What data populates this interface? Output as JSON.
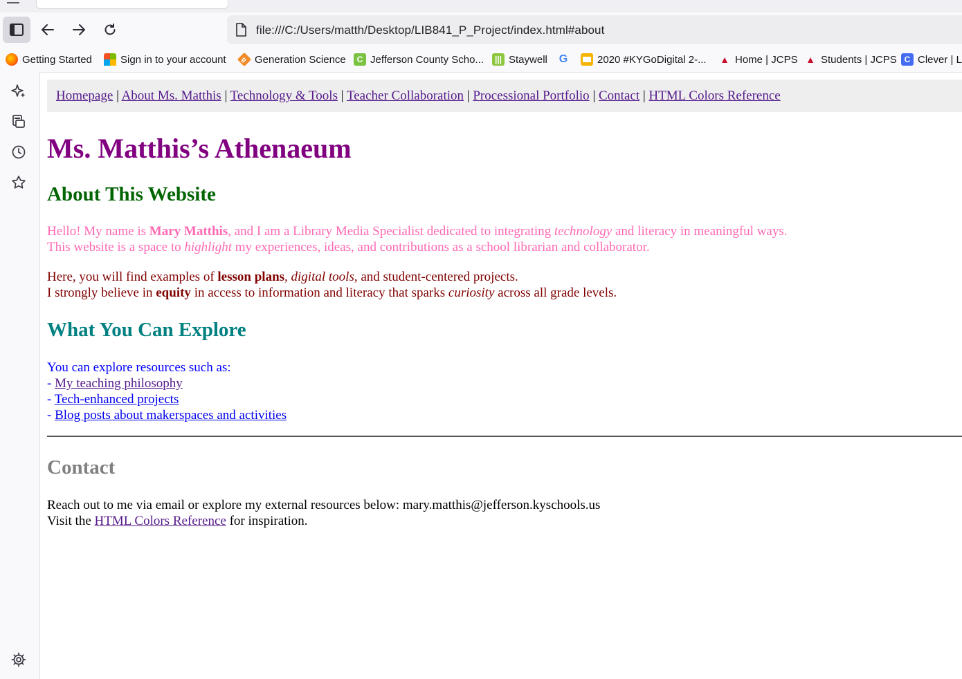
{
  "browser": {
    "url": "file:///C:/Users/matth/Desktop/LIB841_P_Project/index.html#about",
    "bookmarks": [
      {
        "label": "Getting Started",
        "icon": "firefox-icon"
      },
      {
        "label": "Sign in to your account",
        "icon": "microsoft-icon"
      },
      {
        "label": "Generation Science",
        "icon": "generation-science-icon"
      },
      {
        "label": "Jefferson County Scho...",
        "icon": "clever-green-icon"
      },
      {
        "label": "Staywell",
        "icon": "staywell-icon"
      },
      {
        "label": "",
        "icon": "google-icon"
      },
      {
        "label": "2020 #KYGoDigital 2-...",
        "icon": "slides-icon"
      },
      {
        "label": "Home | JCPS",
        "icon": "jcps-icon"
      },
      {
        "label": "Students | JCPS",
        "icon": "jcps-students-icon"
      },
      {
        "label": "Clever | Lo",
        "icon": "clever-icon"
      }
    ]
  },
  "nav": {
    "links": [
      "Homepage",
      "About Ms. Matthis",
      "Technology & Tools",
      "Teacher Collaboration",
      "Processional Portfolio",
      "Contact",
      "HTML Colors Reference"
    ],
    "separator": " | "
  },
  "page": {
    "title": "Ms. Matthis’s Athenaeum",
    "about_heading": "About This Website",
    "about_p1": {
      "t1": "Hello! My name is ",
      "name": "Mary Matthis",
      "t2": ", and I am a Library Media Specialist dedicated to integrating ",
      "tech": "technology",
      "t3": " and literacy in meaningful ways.",
      "t4": "This website is a space to ",
      "highlight": "highlight",
      "t5": " my experiences, ideas, and contributions as a school librarian and collaborator."
    },
    "about_p2": {
      "t1": "Here, you will find examples of ",
      "lesson": "lesson plans",
      "t2": ", ",
      "digital": "digital tools",
      "t3": ", and student-centered projects.",
      "t4": "I strongly believe in ",
      "equity": "equity",
      "t5": " in access to information and literacy that sparks ",
      "curiosity": "curiosity",
      "t6": " across all grade levels."
    },
    "explore_heading": "What You Can Explore",
    "explore_intro": "You can explore resources such as:",
    "explore_dash": "- ",
    "explore_links": [
      "My teaching philosophy",
      "Tech-enhanced projects",
      "Blog posts about makerspaces and activities"
    ],
    "contact_heading": "Contact",
    "contact_line1": "Reach out to me via email or explore my external resources below: mary.matthis@jefferson.kyschools.us",
    "contact_line2_a": "Visit the ",
    "contact_link": "HTML Colors Reference",
    "contact_line2_b": " for inspiration."
  },
  "colors": {
    "title": "#800080",
    "about_heading": "#006400",
    "about_p1": "#ff69b4",
    "about_p2": "#800000",
    "explore_heading": "#008080",
    "explore_text": "#0000ff",
    "contact_heading": "#808080",
    "visited_link": "#551a8b"
  }
}
